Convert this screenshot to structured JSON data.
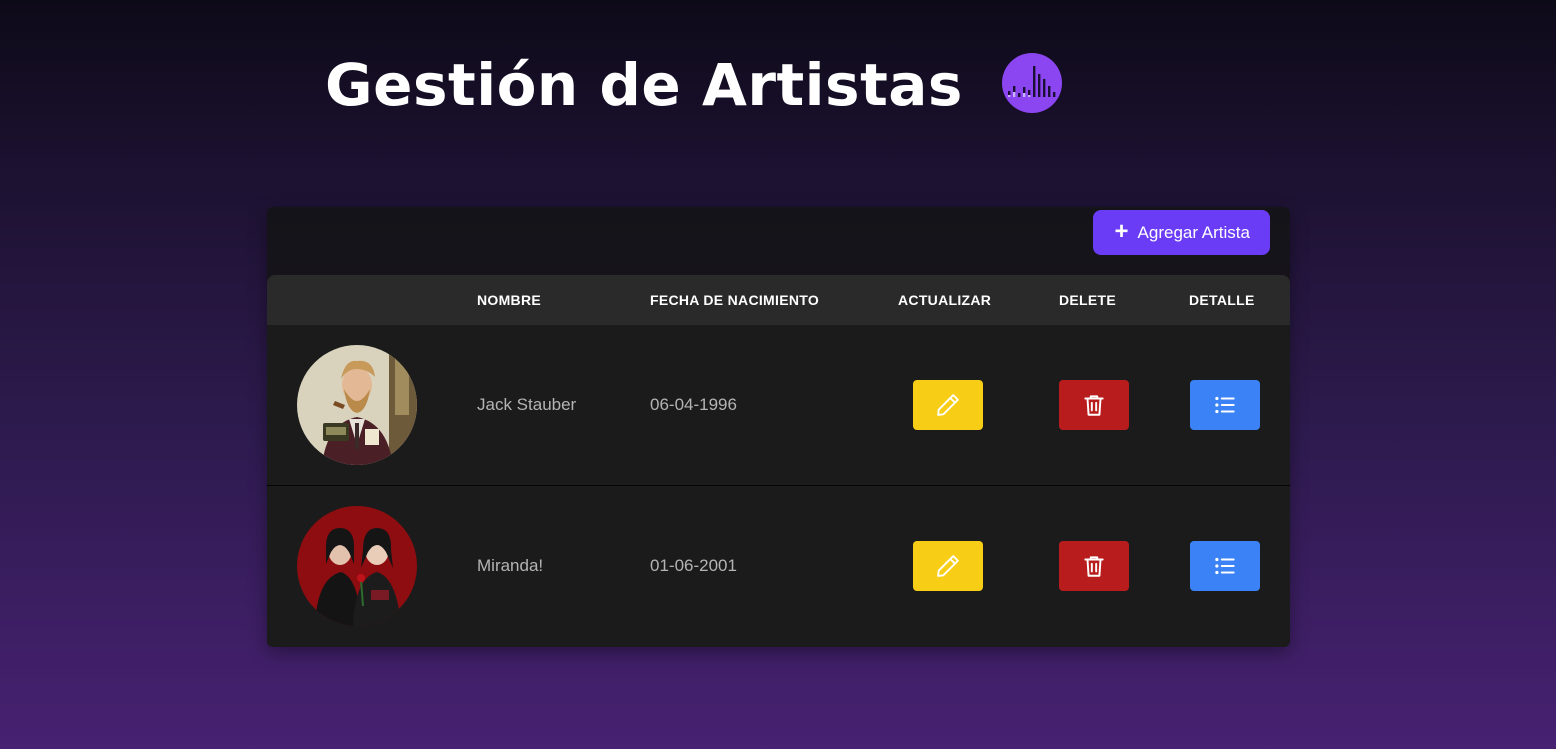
{
  "header": {
    "title": "Gestión de Artistas",
    "logo_icon": "sound-bars-icon"
  },
  "toolbar": {
    "add_label": "Agregar Artista",
    "add_icon": "plus-icon"
  },
  "table": {
    "columns": [
      "",
      "NOMBRE",
      "FECHA DE NACIMIENTO",
      "ACTUALIZAR",
      "DELETE",
      "DETALLE"
    ],
    "rows": [
      {
        "nombre": "Jack Stauber",
        "fecha": "06-04-1996",
        "avatar": "artist-photo-jack-stauber"
      },
      {
        "nombre": "Miranda!",
        "fecha": "01-06-2001",
        "avatar": "artist-photo-miranda"
      }
    ],
    "actions": {
      "edit_icon": "pencil-icon",
      "delete_icon": "trash-icon",
      "detail_icon": "list-icon"
    }
  },
  "colors": {
    "accent": "#6a3cf6",
    "logo": "#8b46f2",
    "edit": "#f8cd16",
    "delete": "#b91c1c",
    "detail": "#3b82f6",
    "table_header": "#2a2a2a",
    "table_row": "#1b1b1b"
  }
}
